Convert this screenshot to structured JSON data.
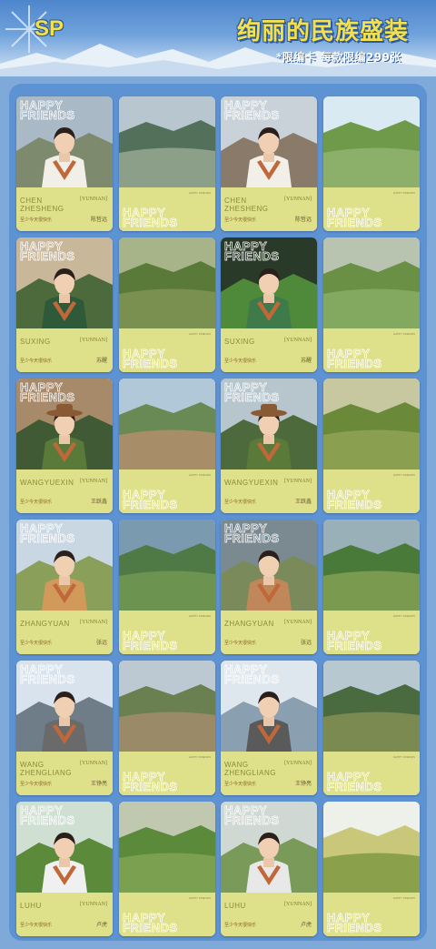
{
  "header": {
    "sp_label": "SP",
    "title": "绚丽的民族盛装",
    "subtitle": "*限编卡  每款限编299张"
  },
  "card_text": {
    "happy_line1": "HAPPY",
    "happy_line2": "FRIENDS",
    "location_tag": "[YUNNAN]",
    "show_name": "至少今天很快乐",
    "small_code": "HAPPY FRIENDS"
  },
  "cards": [
    {
      "name_line1": "CHEN",
      "name_line2": "ZHESHENG",
      "signature": "陈哲远"
    },
    {
      "name_line1": "SUXING",
      "name_line2": "",
      "signature": "苏醒"
    },
    {
      "name_line1": "WANGYUEXIN",
      "name_line2": "",
      "signature": "王跃鑫"
    },
    {
      "name_line1": "ZHANGYUAN",
      "name_line2": "",
      "signature": "张远"
    },
    {
      "name_line1": "WANG",
      "name_line2": "ZHENGLIANG",
      "signature": "王铮亮"
    },
    {
      "name_line1": "LUHU",
      "name_line2": "",
      "signature": "卢虎"
    }
  ],
  "colors": {
    "band": "#dfe08a",
    "board": "#5d92d3",
    "title_yellow": "#f4e04a"
  }
}
